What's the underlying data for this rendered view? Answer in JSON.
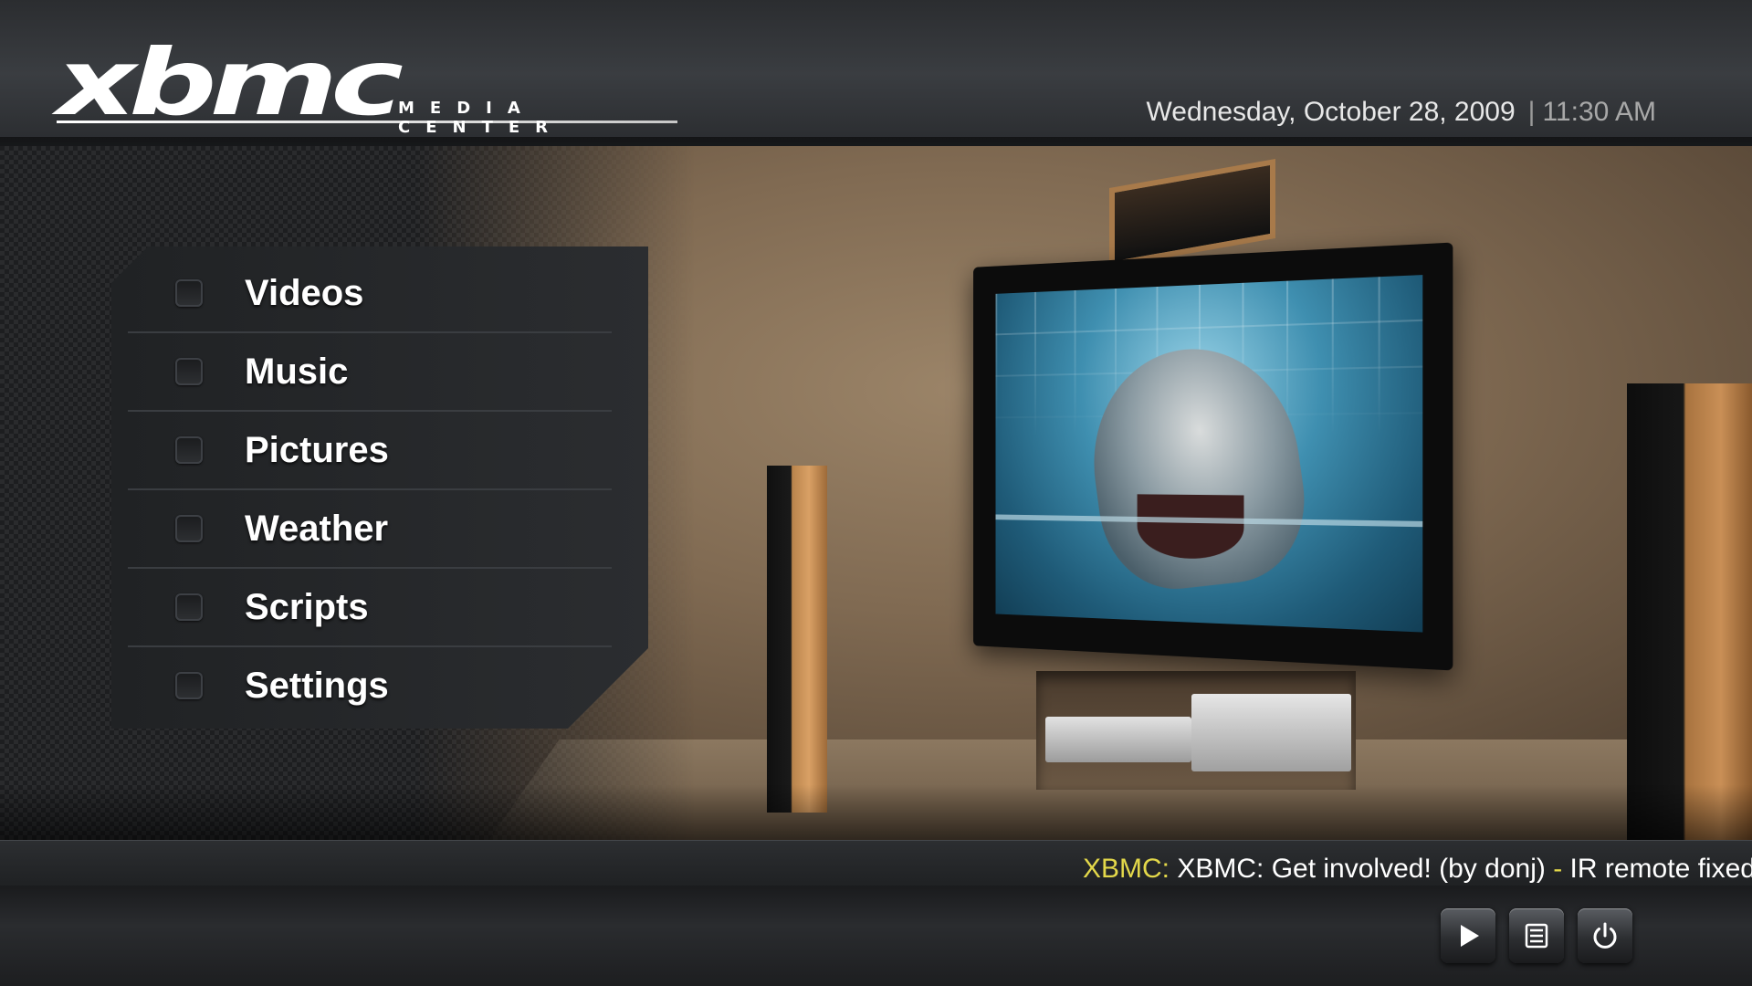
{
  "header": {
    "logo_mark": "xbmc",
    "logo_subtitle": "MEDIA CENTER",
    "date": "Wednesday, October 28, 2009",
    "separator": "|",
    "time": "11:30 AM"
  },
  "menu": {
    "items": [
      {
        "label": "Videos"
      },
      {
        "label": "Music"
      },
      {
        "label": "Pictures"
      },
      {
        "label": "Weather"
      },
      {
        "label": "Scripts"
      },
      {
        "label": "Settings"
      }
    ]
  },
  "ticker": {
    "source": "XBMC:",
    "headline": "XBMC: Get involved! (by donj)",
    "dash": "-",
    "next": "IR remote fixed"
  },
  "controls": {
    "icons": [
      "play-icon",
      "playlist-icon",
      "power-icon"
    ]
  },
  "colors": {
    "ticker_accent": "#e3d84a",
    "text_primary": "#ffffff",
    "time_gray": "#a8a8a8"
  }
}
